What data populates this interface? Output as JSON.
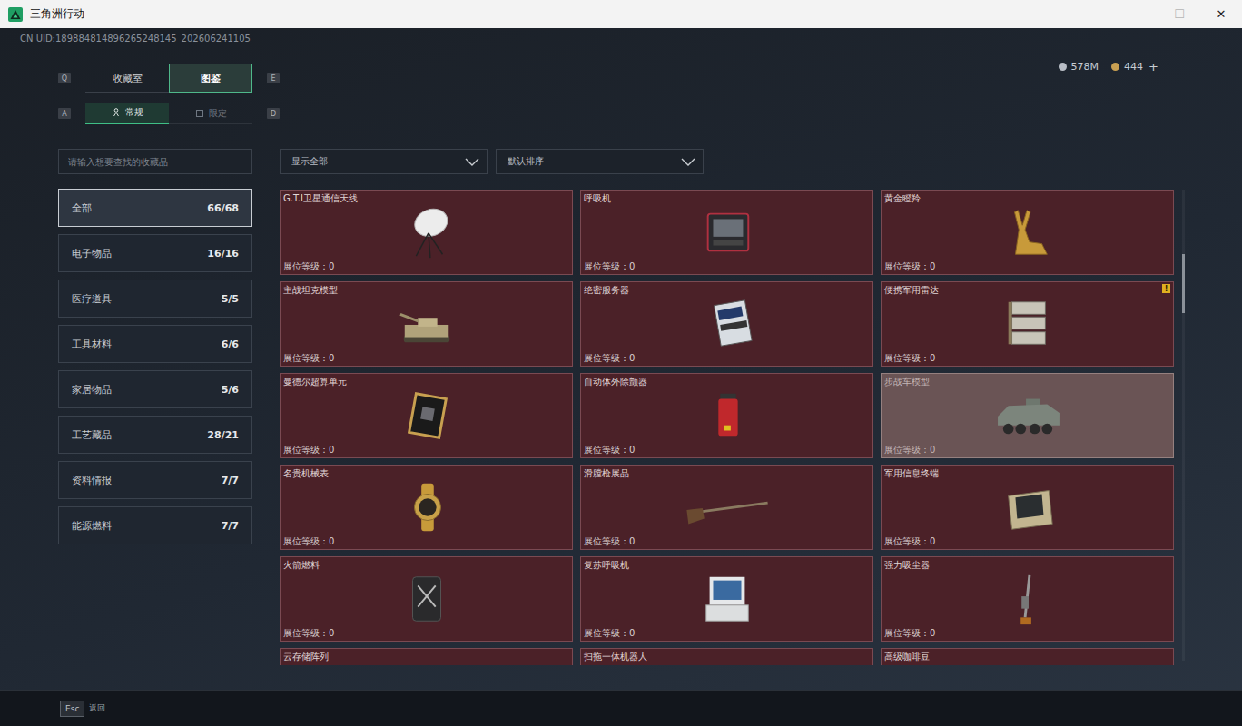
{
  "window": {
    "title": "三角洲行动",
    "controls": [
      {
        "glyph": "—",
        "disabled": false
      },
      {
        "glyph": "☐",
        "disabled": true
      },
      {
        "glyph": "✕",
        "disabled": false
      }
    ]
  },
  "uid": "CN UID:189884814896265248145_202606241105",
  "currencies": [
    {
      "amount": "578M",
      "color": "#b9bec6"
    },
    {
      "amount": "444",
      "color": "#c9a052"
    }
  ],
  "add_button": "+",
  "main_tabs": {
    "prev_key": "Q",
    "next_key": "E",
    "items": [
      {
        "label": "收藏室",
        "selected": false
      },
      {
        "label": "图鉴",
        "selected": true
      }
    ]
  },
  "sub_tabs": {
    "prev_key": "A",
    "next_key": "D",
    "items": [
      {
        "label": "常规",
        "selected": true,
        "kind": "regular"
      },
      {
        "label": "限定",
        "selected": false,
        "kind": "limited"
      }
    ]
  },
  "search": {
    "placeholder": "请输入想要查找的收藏品"
  },
  "filters": [
    {
      "label": "显示全部"
    },
    {
      "label": "默认排序"
    }
  ],
  "categories": [
    {
      "label": "全部",
      "count": "66/68",
      "selected": true
    },
    {
      "label": "电子物品",
      "count": "16/16",
      "selected": false
    },
    {
      "label": "医疗道具",
      "count": "5/5",
      "selected": false
    },
    {
      "label": "工具材料",
      "count": "6/6",
      "selected": false
    },
    {
      "label": "家居物品",
      "count": "5/6",
      "selected": false
    },
    {
      "label": "工艺藏品",
      "count": "28/21",
      "selected": false
    },
    {
      "label": "资料情报",
      "count": "7/7",
      "selected": false
    },
    {
      "label": "能源燃料",
      "count": "7/7",
      "selected": false
    }
  ],
  "level_label": "展位等级：",
  "items": [
    {
      "name": "G.T.I卫星通信天线",
      "display_level": "0",
      "kind": "dish",
      "highlighted": false
    },
    {
      "name": "呼吸机",
      "display_level": "0",
      "kind": "breather",
      "highlighted": false
    },
    {
      "name": "黄金瞪羚",
      "display_level": "0",
      "kind": "gazelle",
      "highlighted": false
    },
    {
      "name": "主战坦克模型",
      "display_level": "0",
      "kind": "tank",
      "highlighted": false
    },
    {
      "name": "绝密服务器",
      "display_level": "0",
      "kind": "server",
      "highlighted": false
    },
    {
      "name": "便携军用雷达",
      "display_level": "0",
      "kind": "radar",
      "highlighted": false,
      "badge": "!"
    },
    {
      "name": "曼德尔超算单元",
      "display_level": "0",
      "kind": "board",
      "highlighted": false
    },
    {
      "name": "自动体外除颤器",
      "display_level": "0",
      "kind": "defib",
      "highlighted": false
    },
    {
      "name": "步战车模型",
      "display_level": "0",
      "kind": "vehicle",
      "highlighted": true
    },
    {
      "name": "名贵机械表",
      "display_level": "0",
      "kind": "watch",
      "highlighted": false
    },
    {
      "name": "滑膛枪展品",
      "display_level": "0",
      "kind": "rifle",
      "highlighted": false
    },
    {
      "name": "军用信息终端",
      "display_level": "0",
      "kind": "case",
      "highlighted": false
    },
    {
      "name": "火箭燃料",
      "display_level": "0",
      "kind": "canister",
      "highlighted": false
    },
    {
      "name": "复苏呼吸机",
      "display_level": "0",
      "kind": "medmonitor",
      "highlighted": false
    },
    {
      "name": "强力吸尘器",
      "display_level": "0",
      "kind": "vacuum",
      "highlighted": false
    },
    {
      "name": "云存储阵列",
      "highlighted": false
    },
    {
      "name": "扫拖一体机器人",
      "highlighted": false
    },
    {
      "name": "高级咖啡豆",
      "highlighted": false
    }
  ],
  "scrollbar": {
    "offset": 0.137,
    "share": 0.125
  },
  "footer": {
    "key": "Esc",
    "label": "返回"
  }
}
